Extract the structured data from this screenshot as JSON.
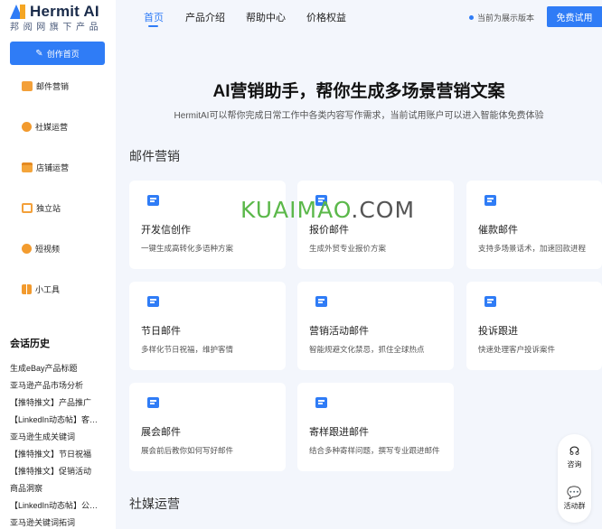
{
  "app": {
    "logo_text": "Hermit AI",
    "logo_sub": "邦阅网旗下产品"
  },
  "sidebar": {
    "create_label": "创作首页",
    "items": [
      {
        "label": "邮件营销",
        "icon": "mail-icon"
      },
      {
        "label": "社媒运营",
        "icon": "social-icon"
      },
      {
        "label": "店铺运营",
        "icon": "shop-icon"
      },
      {
        "label": "独立站",
        "icon": "website-icon"
      },
      {
        "label": "短视频",
        "icon": "video-icon"
      },
      {
        "label": "小工具",
        "icon": "tools-icon"
      }
    ],
    "history_title": "会话历史",
    "history": [
      "生成eBay产品标题",
      "亚马逊产品市场分析",
      "【推特推文】产品推广",
      "【LinkedIn动态帖】客户案例",
      "亚马逊生成关键词",
      "【推特推文】节日祝福",
      "【推特推文】促销活动",
      "商品洞察",
      "【LinkedIn动态帖】公司动态",
      "亚马逊关键词拓词"
    ]
  },
  "topbar": {
    "tabs": [
      "首页",
      "产品介绍",
      "帮助中心",
      "价格权益"
    ],
    "active_tab": "首页",
    "version_text": "当前为展示版本",
    "trial_label": "免费试用"
  },
  "hero": {
    "title": "AI营销助手，帮你生成多场景营销文案",
    "subtitle": "HermitAI可以帮你完成日常工作中各类内容写作需求，当前试用账户可以进入智能体免费体验"
  },
  "sections": [
    {
      "title": "邮件营销",
      "cards": [
        {
          "title": "开发信创作",
          "desc": "一键生成高转化多语种方案"
        },
        {
          "title": "报价邮件",
          "desc": "生成外贸专业报价方案"
        },
        {
          "title": "催款邮件",
          "desc": "支持多场景话术，加速回款进程"
        },
        {
          "title": "节日邮件",
          "desc": "多样化节日祝福，维护客情"
        },
        {
          "title": "营销活动邮件",
          "desc": "智能规避文化禁忌，抓住全球热点"
        },
        {
          "title": "投诉跟进",
          "desc": "快速处理客户投诉案件"
        },
        {
          "title": "展会邮件",
          "desc": "展会前后教你如何写好邮件"
        },
        {
          "title": "寄样跟进邮件",
          "desc": "结合多种寄样问题，撰写专业跟进邮件"
        }
      ]
    },
    {
      "title": "社媒运营"
    }
  ],
  "watermark": {
    "part_a": "KUAIMAO",
    "part_b": ".COM"
  },
  "float": {
    "consult": "咨询",
    "group": "活动群"
  },
  "colors": {
    "accent": "#2f7cf6",
    "icon_orange": "#f3a03a",
    "background": "#f3f6fc"
  }
}
